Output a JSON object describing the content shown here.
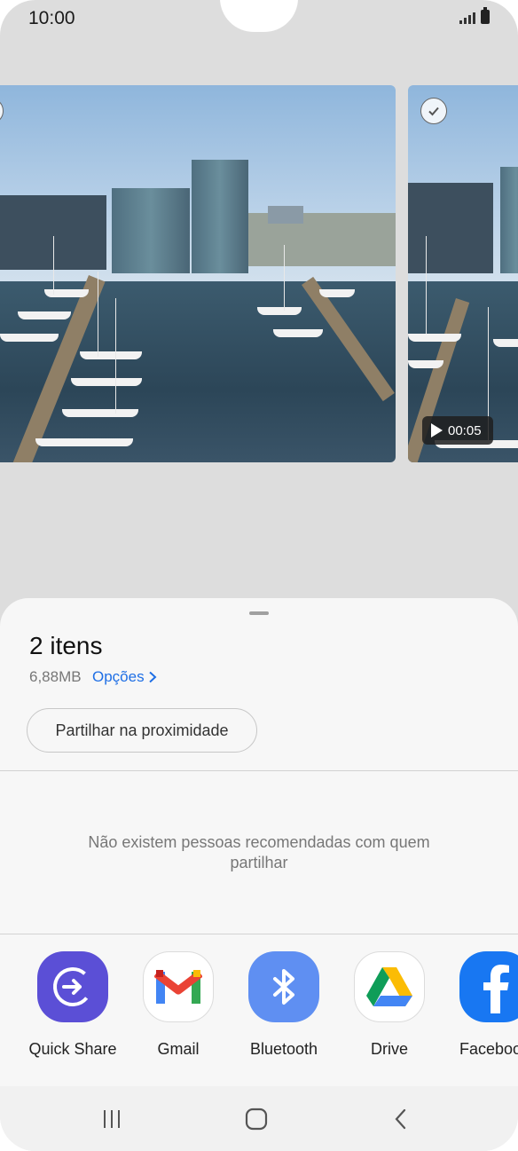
{
  "status_bar": {
    "time": "10:00"
  },
  "gallery": {
    "video_duration": "00:05"
  },
  "share_sheet": {
    "title": "2 itens",
    "size": "6,88MB",
    "options_label": "Opções",
    "nearby_button": "Partilhar na proximidade",
    "empty_message": "Não existem pessoas recomendadas com quem partilhar",
    "apps": [
      {
        "label": "Quick Share",
        "icon": "quick-share-icon",
        "color": "#5b4fd6"
      },
      {
        "label": "Gmail",
        "icon": "gmail-icon",
        "color": "#ffffff"
      },
      {
        "label": "Bluetooth",
        "icon": "bluetooth-icon",
        "color": "#5f8ff2"
      },
      {
        "label": "Drive",
        "icon": "drive-icon",
        "color": "#ffffff"
      },
      {
        "label": "Faceboo",
        "icon": "facebook-icon",
        "color": "#1877f2"
      }
    ]
  },
  "nav_bar": {
    "recents": "recents-icon",
    "home": "home-icon",
    "back": "back-icon"
  }
}
